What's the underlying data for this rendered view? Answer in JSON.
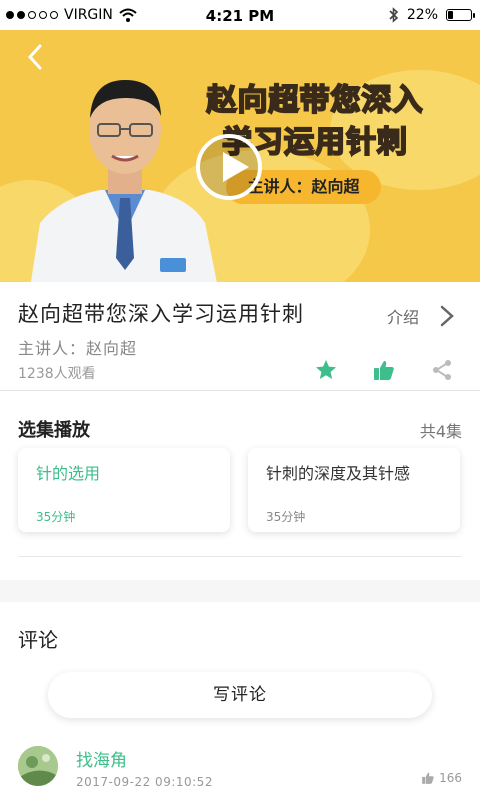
{
  "status_bar": {
    "carrier": "VIRGIN",
    "time": "4:21 PM",
    "battery_text": "22%",
    "battery_level": 0.22
  },
  "banner": {
    "title_line1": "赵向超带您深入",
    "title_line2": "学习运用针刺",
    "lecturer_tag": "主讲人：赵向超",
    "colors": {
      "background": "#f5c84a",
      "accent": "#f6b62e"
    }
  },
  "course": {
    "title": "赵向超带您深入学习运用针刺",
    "intro_label": "介绍",
    "lecturer": "主讲人：赵向超",
    "views": "1238人观看"
  },
  "episodes": {
    "section_title": "选集播放",
    "count_label": "共4集",
    "items": [
      {
        "name": "针的选用",
        "duration": "35分钟",
        "active": true
      },
      {
        "name": "针刺的深度及其针感",
        "duration": "35分钟",
        "active": false
      }
    ]
  },
  "comments": {
    "section_title": "评论",
    "write_label": "写评论",
    "items": [
      {
        "user": "找海角",
        "time": "2017-09-22  09:10:52",
        "likes": "166"
      }
    ]
  },
  "colors": {
    "accent_green": "#3dbe8a"
  }
}
